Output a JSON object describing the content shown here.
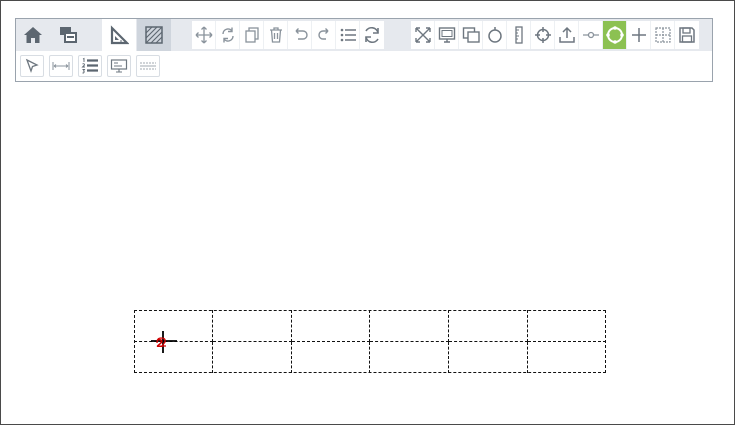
{
  "window": {
    "title": ""
  },
  "tabs": [
    {
      "id": "home",
      "icon": "home-icon"
    },
    {
      "id": "objects",
      "icon": "layers-icon"
    },
    {
      "id": "geometry",
      "icon": "set-square-icon",
      "active": true
    },
    {
      "id": "fill",
      "icon": "hatch-fill-icon"
    }
  ],
  "toolbar_edit": [
    {
      "id": "move",
      "icon": "move-icon"
    },
    {
      "id": "rotate",
      "icon": "rotate-icon"
    },
    {
      "id": "copy",
      "icon": "copy-icon"
    },
    {
      "id": "delete",
      "icon": "trash-icon"
    },
    {
      "id": "undo",
      "icon": "undo-icon"
    },
    {
      "id": "redo",
      "icon": "redo-icon"
    },
    {
      "id": "list",
      "icon": "list-icon"
    },
    {
      "id": "refresh",
      "icon": "refresh-icon"
    }
  ],
  "toolbar_view": [
    {
      "id": "fit",
      "icon": "fit-screen-icon"
    },
    {
      "id": "screen",
      "icon": "monitor-icon"
    },
    {
      "id": "window",
      "icon": "window-icon"
    },
    {
      "id": "circle",
      "icon": "circle-icon"
    },
    {
      "id": "ruler",
      "icon": "ruler-icon"
    },
    {
      "id": "crosshair",
      "icon": "crosshair-icon"
    },
    {
      "id": "export",
      "icon": "upload-icon"
    },
    {
      "id": "line-point",
      "icon": "line-point-icon"
    },
    {
      "id": "snap",
      "icon": "snap-circle-icon",
      "active": true
    },
    {
      "id": "plus",
      "icon": "plus-icon"
    },
    {
      "id": "grid",
      "icon": "grid-icon"
    },
    {
      "id": "save",
      "icon": "save-icon"
    }
  ],
  "toolbar_row2": [
    {
      "id": "select",
      "icon": "pointer-icon"
    },
    {
      "id": "dimension",
      "icon": "dimension-icon"
    },
    {
      "id": "numbered-list",
      "icon": "numbered-list-icon"
    },
    {
      "id": "display",
      "icon": "display-icon"
    },
    {
      "id": "dashed-line",
      "icon": "dashed-line-icon"
    }
  ],
  "canvas": {
    "grid": {
      "columns": 6,
      "rows": 2,
      "line_color": "#111111",
      "style": "dashed"
    },
    "point_label": "2",
    "point_color": "#d00000",
    "accent_color": "#8cc152"
  }
}
